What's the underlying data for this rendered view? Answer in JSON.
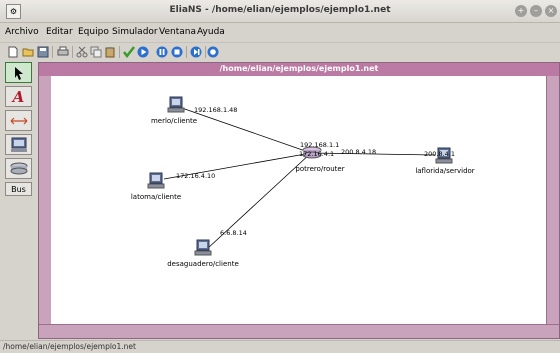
{
  "window": {
    "title": "EliaNS - /home/elian/ejemplos/ejemplo1.net"
  },
  "menu": [
    "Archivo",
    "Editar",
    "Equipo",
    "Simulador",
    "Ventana",
    "Ayuda"
  ],
  "palette": {
    "bus_label": "Bus"
  },
  "document": {
    "title": "/home/elian/ejemplos/ejemplo1.net"
  },
  "network": {
    "nodes": [
      {
        "id": "merlo",
        "label": "merlo/cliente",
        "type": "computer"
      },
      {
        "id": "latoma",
        "label": "latoma/cliente",
        "type": "computer"
      },
      {
        "id": "desaguadero",
        "label": "desaguadero/cliente",
        "type": "computer"
      },
      {
        "id": "potrero",
        "label": "potrero/router",
        "type": "router"
      },
      {
        "id": "laflorida",
        "label": "laflorida/servidor",
        "type": "computer"
      }
    ],
    "links": [
      {
        "from": "merlo",
        "to": "potrero",
        "ip_from": "192.168.1.48",
        "ip_to": "192.168.1.1"
      },
      {
        "from": "latoma",
        "to": "potrero",
        "ip_from": "172.16.4.10",
        "ip_to": "172.16.4.1"
      },
      {
        "from": "desaguadero",
        "to": "potrero",
        "ip_from": "6.6.8.14",
        "ip_to": ""
      },
      {
        "from": "potrero",
        "to": "laflorida",
        "ip_from": "200.8.4.18",
        "ip_to": "200.8.4.1"
      }
    ]
  },
  "status": {
    "path": "/home/elian/ejemplos/ejemplo1.net"
  }
}
